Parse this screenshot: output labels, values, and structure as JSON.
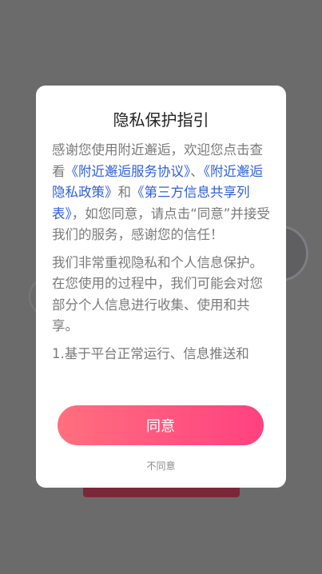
{
  "dialog": {
    "title": "隐私保护指引",
    "para1": {
      "t1": "感谢您使用附近邂逅，欢迎您点击查看",
      "link1": "《附近邂逅服务协议》",
      "t2": "、",
      "link2": "《附近邂逅隐私政策》",
      "t3": "和",
      "link3": "《第三方信息共享列表》",
      "t4": "，如您同意，请点击“同意”并接受我们的服务，感谢您的信任！"
    },
    "para2": "我们非常重视隐私和个人信息保护。在您使用的过程中，我们可能会对您部分个人信息进行收集、使用和共享。",
    "para3": "1.基于平台正常运行、信息推送和",
    "agree_label": "同意",
    "disagree_label": "不同意"
  },
  "colors": {
    "link": "#2f5fd8",
    "button_gradient_start": "#ff6f7e",
    "button_gradient_end": "#ff4180",
    "overlay": "#6b6b6b"
  }
}
